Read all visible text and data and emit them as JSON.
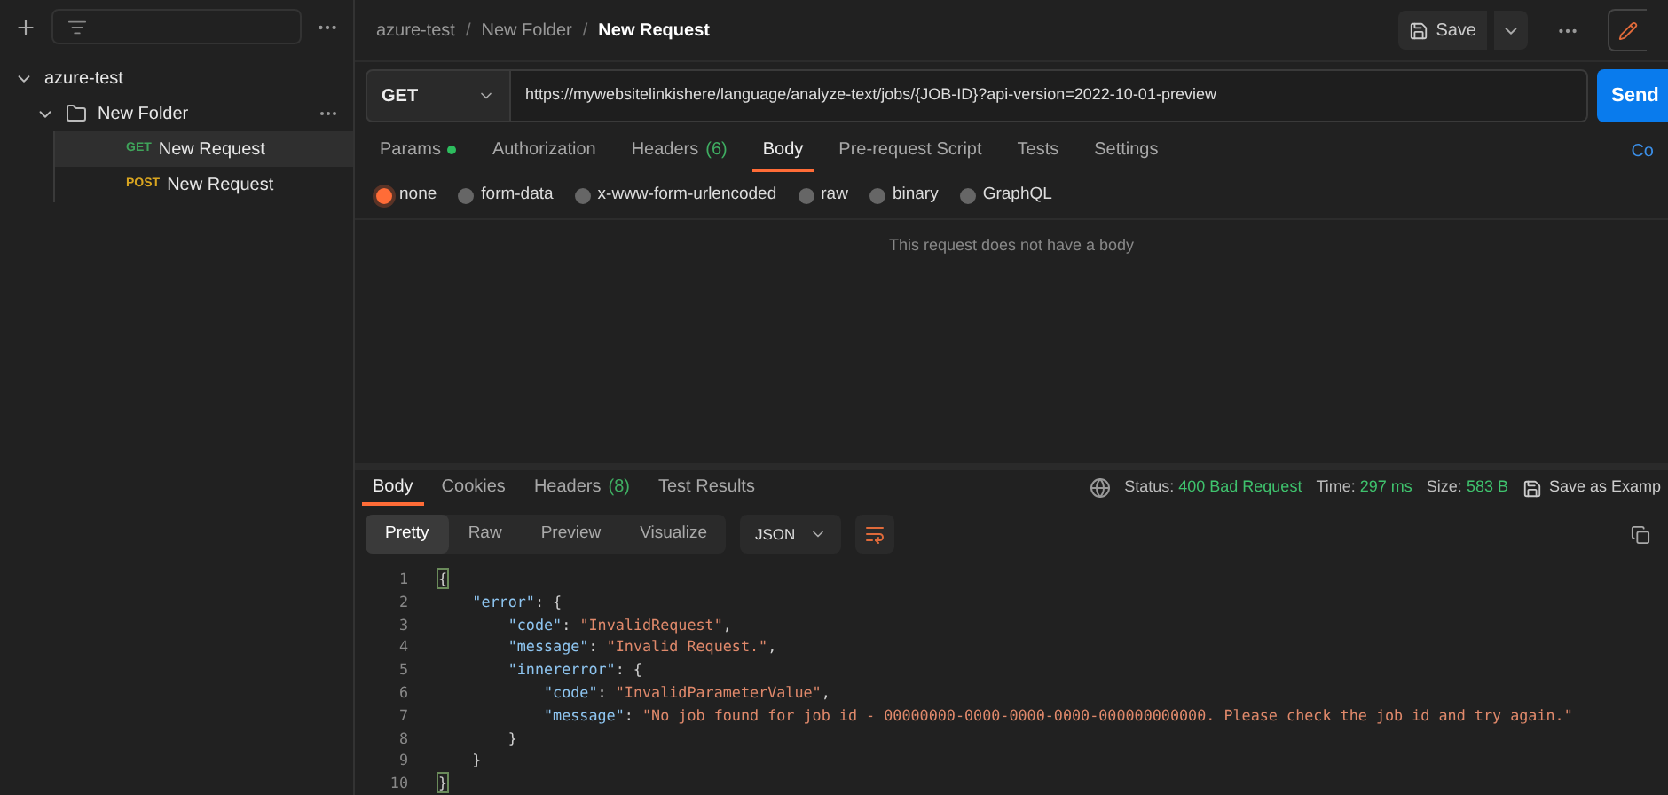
{
  "sidebar": {
    "tree": [
      {
        "label": "azure-test",
        "expanded": true,
        "kind": "collection",
        "children": [
          {
            "label": "New Folder",
            "expanded": true,
            "kind": "folder",
            "children": [
              {
                "label": "New Request",
                "kind": "request",
                "method": "GET",
                "selected": true
              },
              {
                "label": "New Request",
                "kind": "request",
                "method": "POST",
                "selected": false
              }
            ]
          }
        ]
      }
    ]
  },
  "breadcrumb": [
    {
      "label": "azure-test"
    },
    {
      "separator": "/",
      "label": "New Folder"
    },
    {
      "separator": "/",
      "label": "New Request"
    }
  ],
  "save_button": "Save",
  "request": {
    "method": "GET",
    "url": "https://mywebsitelinkishere/language/analyze-text/jobs/{JOB-ID}?api-version=2022-10-01-preview",
    "send": "Send"
  },
  "request_tabs": [
    {
      "label": "Params",
      "selected": false,
      "dot": true
    },
    {
      "label": "Authorization",
      "selected": false
    },
    {
      "label": "Headers",
      "count": "(6)",
      "selected": false
    },
    {
      "label": "Body",
      "selected": true
    },
    {
      "label": "Pre-request Script",
      "selected": false
    },
    {
      "label": "Tests",
      "selected": false
    },
    {
      "label": "Settings",
      "selected": false
    }
  ],
  "cookies_link": "Co",
  "body_types": [
    {
      "label": "none",
      "selected": true
    },
    {
      "label": "form-data",
      "selected": false
    },
    {
      "label": "x-www-form-urlencoded",
      "selected": false
    },
    {
      "label": "raw",
      "selected": false
    },
    {
      "label": "binary",
      "selected": false
    },
    {
      "label": "GraphQL",
      "selected": false
    }
  ],
  "body_message": "This request does not have a body",
  "response_tabs": [
    {
      "label": "Body",
      "selected": true
    },
    {
      "label": "Cookies",
      "selected": false
    },
    {
      "label": "Headers",
      "count": "(8)",
      "selected": false
    },
    {
      "label": "Test Results",
      "selected": false
    }
  ],
  "status": [
    {
      "label": "Status:",
      "value": "400 Bad Request"
    },
    {
      "label": "Time:",
      "value": "297 ms"
    },
    {
      "label": "Size:",
      "value": "583 B"
    }
  ],
  "save_example": "Save as Examp",
  "view_modes": [
    {
      "label": "Pretty",
      "selected": true
    },
    {
      "label": "Raw",
      "selected": false
    },
    {
      "label": "Preview",
      "selected": false
    },
    {
      "label": "Visualize",
      "selected": false
    }
  ],
  "format": "JSON",
  "code_lines": [
    {
      "number": "1",
      "tokens": [
        {
          "kind": "bracket",
          "text": "{"
        }
      ]
    },
    {
      "number": "2",
      "tokens": [
        {
          "kind": "key",
          "text": "    \"error\""
        },
        {
          "kind": "punct",
          "text": ": {"
        }
      ]
    },
    {
      "number": "3",
      "tokens": [
        {
          "kind": "key",
          "text": "        \"code\""
        },
        {
          "kind": "punct",
          "text": ": "
        },
        {
          "kind": "string",
          "text": "\"InvalidRequest\""
        },
        {
          "kind": "punct",
          "text": ","
        }
      ]
    },
    {
      "number": "4",
      "tokens": [
        {
          "kind": "key",
          "text": "        \"message\""
        },
        {
          "kind": "punct",
          "text": ": "
        },
        {
          "kind": "string",
          "text": "\"Invalid Request.\""
        },
        {
          "kind": "punct",
          "text": ","
        }
      ]
    },
    {
      "number": "5",
      "tokens": [
        {
          "kind": "key",
          "text": "        \"innererror\""
        },
        {
          "kind": "punct",
          "text": ": {"
        }
      ]
    },
    {
      "number": "6",
      "tokens": [
        {
          "kind": "key",
          "text": "            \"code\""
        },
        {
          "kind": "punct",
          "text": ": "
        },
        {
          "kind": "string",
          "text": "\"InvalidParameterValue\""
        },
        {
          "kind": "punct",
          "text": ","
        }
      ]
    },
    {
      "number": "7",
      "tokens": [
        {
          "kind": "key",
          "text": "            \"message\""
        },
        {
          "kind": "punct",
          "text": ": "
        },
        {
          "kind": "string",
          "text": "\"No job found for job id - 00000000-0000-0000-0000-000000000000. Please check the job id and try again.\""
        }
      ]
    },
    {
      "number": "8",
      "tokens": [
        {
          "kind": "punct",
          "text": "        }"
        }
      ]
    },
    {
      "number": "9",
      "tokens": [
        {
          "kind": "punct",
          "text": "    }"
        }
      ]
    },
    {
      "number": "10",
      "tokens": [
        {
          "kind": "bracket",
          "text": "}"
        }
      ]
    }
  ]
}
